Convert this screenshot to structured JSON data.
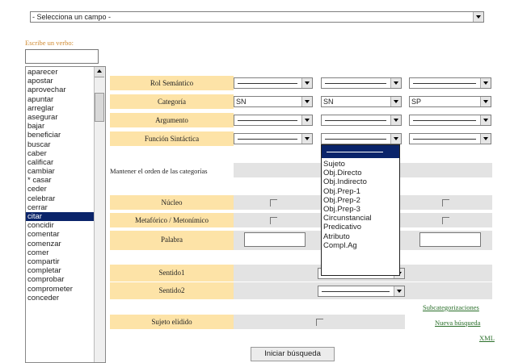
{
  "top_select": "- Selecciona un campo -",
  "verb_panel": {
    "label": "Escribe un verbo:",
    "input_value": "",
    "verbs": [
      "aparecer",
      "apostar",
      "aprovechar",
      "apuntar",
      "arreglar",
      "asegurar",
      "bajar",
      "beneficiar",
      "buscar",
      "caber",
      "calificar",
      "cambiar",
      "* casar",
      "ceder",
      "celebrar",
      "cerrar",
      "citar",
      "concidir",
      "comentar",
      "comenzar",
      "comer",
      "compartir",
      "completar",
      "comprobar",
      "comprometer",
      "conceder"
    ],
    "selected": "citar"
  },
  "form": {
    "rol_label": "Rol Semántico",
    "categoria_label": "Categoría",
    "categoria_values": [
      "SN",
      "SN",
      "SP"
    ],
    "argumento_label": "Argumento",
    "funcion_label": "Función Sintáctica",
    "mantener_label": "Mantener el orden de las categorías",
    "nucleo_label": "Núcleo",
    "metaforico_label": "Metafórico / Metonímico",
    "palabra_label": "Palabra",
    "sentido1_label": "Sentido1",
    "sentido2_label": "Sentido2",
    "sujeto_elidido_label": "Sujeto elidido"
  },
  "dropdown": {
    "items": [
      "Sujeto",
      "Obj.Directo",
      "Obj.Indirecto",
      "Obj.Prep-1",
      "Obj.Prep-2",
      "Obj.Prep-3",
      "Circunstancial",
      "Predicativo",
      "Atributo",
      "Compl.Ag"
    ]
  },
  "links": {
    "subcategorizaciones": "Subcategorizaciones",
    "nueva_busqueda": "Nueva búsqueda",
    "xml": "XML"
  },
  "search_button": "Iniciar búsqueda"
}
